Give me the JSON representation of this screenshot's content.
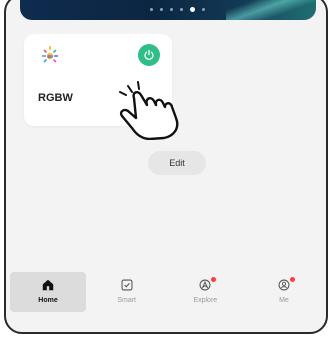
{
  "device": {
    "name": "RGBW",
    "power_state": "on"
  },
  "actions": {
    "edit_label": "Edit"
  },
  "carousel": {
    "page_count": 6,
    "active_index": 4
  },
  "tabbar": {
    "items": [
      {
        "id": "home",
        "label": "Home",
        "icon": "home-icon",
        "active": true,
        "badge": false
      },
      {
        "id": "smart",
        "label": "Smart",
        "icon": "checkbox-icon",
        "active": false,
        "badge": false
      },
      {
        "id": "explore",
        "label": "Explore",
        "icon": "compass-icon",
        "active": false,
        "badge": true
      },
      {
        "id": "me",
        "label": "Me",
        "icon": "user-icon",
        "active": false,
        "badge": true
      }
    ]
  },
  "colors": {
    "power_on": "#2fbf86",
    "badge": "#ff3b3b",
    "banner_dark": "#0f2b4e",
    "background": "#f3f3f4"
  }
}
